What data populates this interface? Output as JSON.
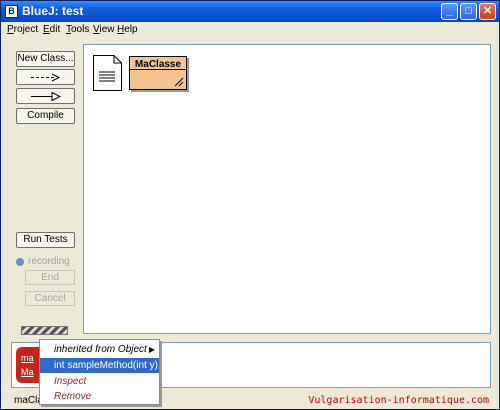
{
  "window": {
    "title": "BlueJ:  test",
    "icon": "bluej-app-icon",
    "controls": {
      "minimize": "_",
      "maximize": "□",
      "close": "✕"
    }
  },
  "menubar": {
    "items": [
      {
        "label": "Project",
        "mnemonic": "P",
        "rest": "roject"
      },
      {
        "label": "Edit",
        "mnemonic": "E",
        "rest": "dit"
      },
      {
        "label": "Tools",
        "mnemonic": "T",
        "rest": "ools"
      },
      {
        "label": "View",
        "mnemonic": "V",
        "rest": "iew"
      },
      {
        "label": "Help",
        "mnemonic": "H",
        "rest": "elp"
      }
    ]
  },
  "toolbar": {
    "new_class": "New Class...",
    "dependency_arrow_icon": "dashed-arrow-icon",
    "inheritance_arrow_icon": "inheritance-arrow-icon",
    "compile": "Compile",
    "run_tests": "Run Tests",
    "recording": "recording",
    "end": "End",
    "cancel": "Cancel"
  },
  "diagram": {
    "readme_icon": "document-icon",
    "classes": [
      {
        "name": "MaClasse",
        "color": "#f5c38e"
      }
    ]
  },
  "bench": {
    "object": {
      "line1": "ma",
      "line2": "Ma",
      "color": "#c5261c"
    }
  },
  "context_menu": {
    "items": [
      {
        "label": "inherited from Object",
        "type": "submenu"
      },
      {
        "label": "int sampleMethod(int y)",
        "type": "selected"
      },
      {
        "label": "Inspect",
        "type": "action"
      },
      {
        "label": "Remove",
        "type": "action"
      }
    ]
  },
  "status": {
    "text": "maCla",
    "watermark": "Vulgarisation-informatique.com"
  }
}
